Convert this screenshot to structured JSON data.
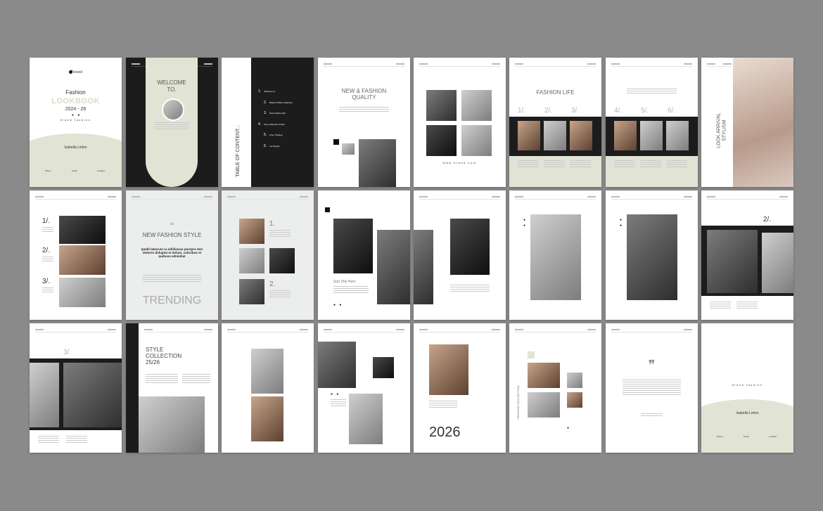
{
  "cover": {
    "brand": "brand",
    "title_top": "Fashion",
    "title_main": "LOOKBOOK",
    "year": "2024 - 26",
    "tagline": "brand fashion",
    "author": "Isabella Linton",
    "contact_labels": [
      "Phone",
      "Email",
      "Location"
    ]
  },
  "welcome": {
    "line1": "WELCOME",
    "line2": "TO."
  },
  "toc": {
    "title": "TABLE OF CONTENT...",
    "items": [
      {
        "num": "1.",
        "label": "Welcome to"
      },
      {
        "num": "2.",
        "label": "Black & White Collection"
      },
      {
        "num": "3.",
        "label": "New Fashion Ma"
      },
      {
        "num": "4.",
        "label": "New Collection Arrival"
      },
      {
        "num": "5.",
        "label": "Free Thinking"
      },
      {
        "num": "6.",
        "label": "Let Design"
      }
    ]
  },
  "quality": {
    "title": "NEW & FASHION QUALITY"
  },
  "website": "www.brand.com",
  "fashion_life": {
    "title": "FASHION LIFE",
    "nums_a": [
      "1/.",
      "2/.",
      "3/."
    ],
    "nums_b": [
      "4/.",
      "5/.",
      "6/."
    ]
  },
  "arrival": {
    "title": "LOOK ARRIVAL STYLISM"
  },
  "numbered": {
    "items": [
      "1/.",
      "2/.",
      "3/."
    ]
  },
  "new_style": {
    "title": "NEW FASHION STYLE",
    "body": "Ipedit laborum ra nihiliacius porepro tem dolores doluptat et dolum, coloribus et quibusa ednisitiat",
    "footer": "TRENDING"
  },
  "grid_numbers": [
    "1.",
    "2."
  ],
  "sub_title": "Sub Title Here",
  "two_slash": "2/.",
  "three_slash": "3/.",
  "style_collection": {
    "title": "STYLE COLLECTION 25/26"
  },
  "year_big": "2026",
  "side_label": "FASHION COLLECTION",
  "back": {
    "tagline": "brand fashion",
    "author": "Isabella Linton",
    "contact_labels": [
      "Phone",
      "Email",
      "Location"
    ]
  }
}
